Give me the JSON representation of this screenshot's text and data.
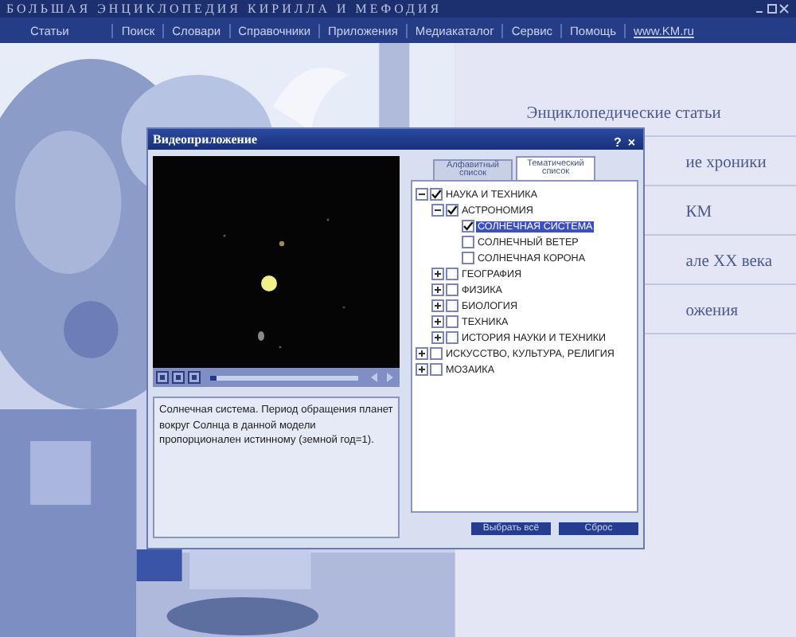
{
  "window": {
    "title": "БОЛЬШАЯ ЭНЦИКЛОПЕДИЯ КИРИЛЛА И МЕФОДИЯ"
  },
  "menu": [
    "Статьи",
    "Поиск",
    "Словари",
    "Справочники",
    "Приложения",
    "Медиакаталог",
    "Сервис",
    "Помощь",
    "www.KM.ru"
  ],
  "links": [
    "Энциклопедические статьи",
    "ие хроники",
    "КМ",
    "але XX века",
    "ожения"
  ],
  "dialog": {
    "title": "Видеоприложение",
    "help": "?",
    "close": "×",
    "player": {
      "level": 0.04
    },
    "description": "Солнечная система. Период обращения планет вокруг Солнца в данной модели пропорционален истинному (земной год=1).",
    "tabs": [
      {
        "label": "Алфавитный список",
        "selected": false
      },
      {
        "label": "Тематический список",
        "selected": true
      }
    ],
    "tree": [
      {
        "label": "НАУКА И ТЕХНИКА",
        "expanded": true,
        "checked": true,
        "selected": false,
        "children": [
          {
            "label": "АСТРОНОМИЯ",
            "expanded": true,
            "checked": true,
            "selected": false,
            "children": [
              {
                "label": "СОЛНЕЧНАЯ СИСТЕМА",
                "checked": true,
                "selected": true
              },
              {
                "label": "СОЛНЕЧНЫЙ ВЕТЕР",
                "checked": false,
                "selected": false
              },
              {
                "label": "СОЛНЕЧНАЯ КОРОНА",
                "checked": false,
                "selected": false
              }
            ]
          },
          {
            "label": "ГЕОГРАФИЯ",
            "expanded": false,
            "checked": false,
            "selected": false
          },
          {
            "label": "ФИЗИКА",
            "expanded": false,
            "checked": false,
            "selected": false
          },
          {
            "label": "БИОЛОГИЯ",
            "expanded": false,
            "checked": false,
            "selected": false
          },
          {
            "label": "ТЕХНИКА",
            "expanded": false,
            "checked": false,
            "selected": false
          },
          {
            "label": "ИСТОРИЯ НАУКИ И ТЕХНИКИ",
            "expanded": false,
            "checked": false,
            "selected": false
          }
        ]
      },
      {
        "label": "ИСКУССТВО, КУЛЬТУРА, РЕЛИГИЯ",
        "expanded": false,
        "checked": false,
        "selected": false
      },
      {
        "label": "МОЗАИКА",
        "expanded": false,
        "checked": false,
        "selected": false
      }
    ],
    "buttons": [
      "Выбрать всё",
      "Сброс"
    ]
  }
}
